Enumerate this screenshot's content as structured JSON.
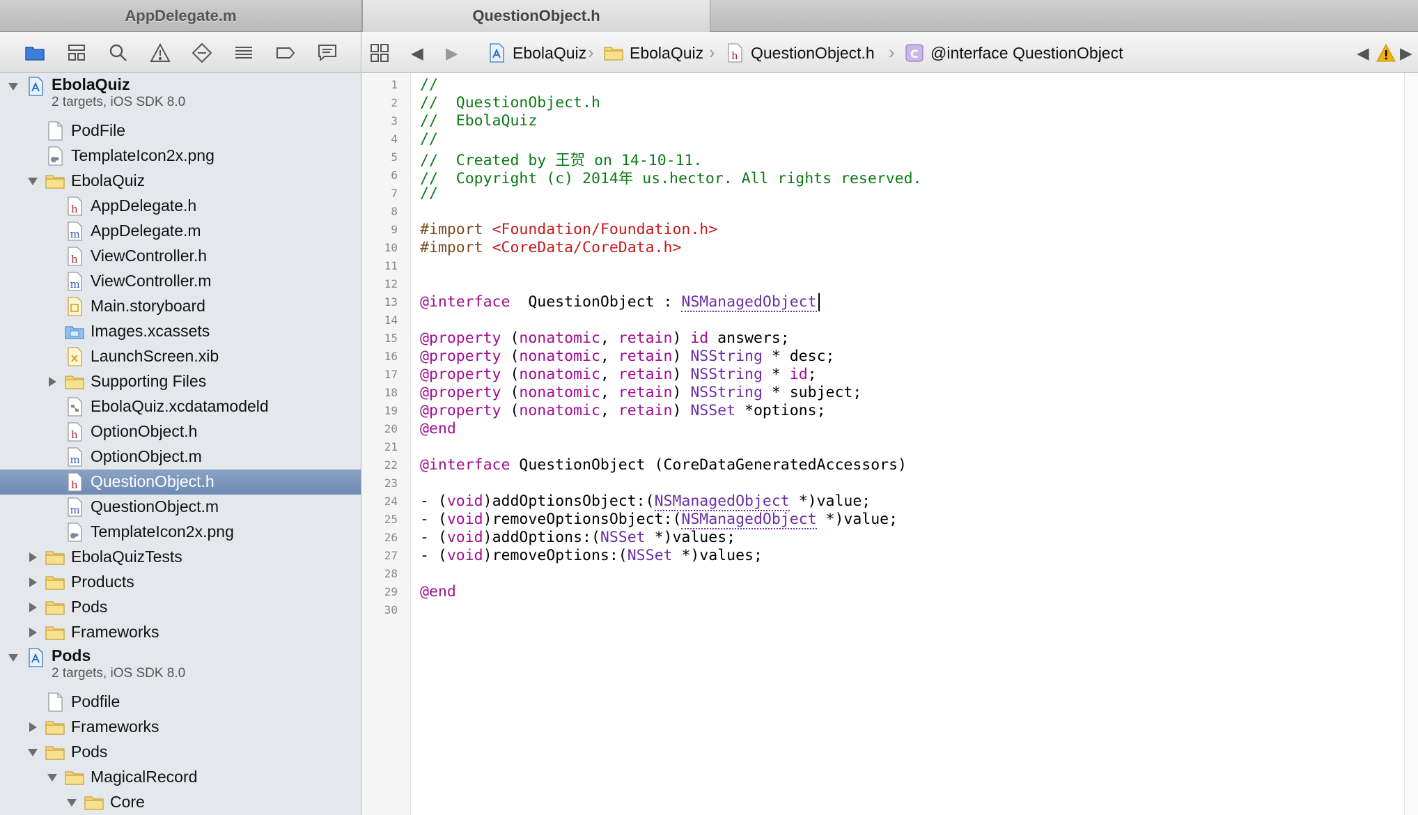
{
  "tabs": [
    {
      "label": "AppDelegate.m"
    },
    {
      "label": "QuestionObject.h"
    }
  ],
  "navigator": {
    "toolbar_icons": [
      "folder-icon",
      "hierarchy-icon",
      "search-icon",
      "warning-icon",
      "diamond-icon",
      "list-icon",
      "tag-icon",
      "chat-icon"
    ],
    "tree": [
      {
        "label": "EbolaQuiz",
        "sub": "2 targets, iOS SDK 8.0",
        "icon": "project",
        "indent": 0,
        "disclosure": "open",
        "project": true
      },
      {
        "label": "PodFile",
        "icon": "doc",
        "indent": 1
      },
      {
        "label": "TemplateIcon2x.png",
        "icon": "image",
        "indent": 1
      },
      {
        "label": "EbolaQuiz",
        "icon": "folder",
        "indent": 1,
        "disclosure": "open"
      },
      {
        "label": "AppDelegate.h",
        "icon": "h",
        "indent": 2
      },
      {
        "label": "AppDelegate.m",
        "icon": "m",
        "indent": 2
      },
      {
        "label": "ViewController.h",
        "icon": "h",
        "indent": 2
      },
      {
        "label": "ViewController.m",
        "icon": "m",
        "indent": 2
      },
      {
        "label": "Main.storyboard",
        "icon": "storyboard",
        "indent": 2
      },
      {
        "label": "Images.xcassets",
        "icon": "xcassets",
        "indent": 2
      },
      {
        "label": "LaunchScreen.xib",
        "icon": "xib",
        "indent": 2
      },
      {
        "label": "Supporting Files",
        "icon": "folder",
        "indent": 2,
        "disclosure": "closed"
      },
      {
        "label": "EbolaQuiz.xcdatamodeld",
        "icon": "datamodel",
        "indent": 2
      },
      {
        "label": "OptionObject.h",
        "icon": "h",
        "indent": 2
      },
      {
        "label": "OptionObject.m",
        "icon": "m",
        "indent": 2
      },
      {
        "label": "QuestionObject.h",
        "icon": "h",
        "indent": 2,
        "selected": true
      },
      {
        "label": "QuestionObject.m",
        "icon": "m",
        "indent": 2
      },
      {
        "label": "TemplateIcon2x.png",
        "icon": "image",
        "indent": 2
      },
      {
        "label": "EbolaQuizTests",
        "icon": "folder",
        "indent": 1,
        "disclosure": "closed"
      },
      {
        "label": "Products",
        "icon": "folder",
        "indent": 1,
        "disclosure": "closed"
      },
      {
        "label": "Pods",
        "icon": "folder",
        "indent": 1,
        "disclosure": "closed"
      },
      {
        "label": "Frameworks",
        "icon": "folder",
        "indent": 1,
        "disclosure": "closed"
      },
      {
        "label": "Pods",
        "sub": "2 targets, iOS SDK 8.0",
        "icon": "project",
        "indent": 0,
        "disclosure": "open",
        "project": true
      },
      {
        "label": "Podfile",
        "icon": "doc",
        "indent": 1
      },
      {
        "label": "Frameworks",
        "icon": "folder",
        "indent": 1,
        "disclosure": "closed"
      },
      {
        "label": "Pods",
        "icon": "folder",
        "indent": 1,
        "disclosure": "open"
      },
      {
        "label": "MagicalRecord",
        "icon": "folder",
        "indent": 2,
        "disclosure": "open"
      },
      {
        "label": "Core",
        "icon": "folder",
        "indent": 3,
        "disclosure": "open"
      }
    ]
  },
  "jumpbar": {
    "items": [
      {
        "label": "EbolaQuiz",
        "icon": "project"
      },
      {
        "label": "EbolaQuiz",
        "icon": "folder"
      },
      {
        "label": "QuestionObject.h",
        "icon": "h"
      },
      {
        "label": "@interface QuestionObject",
        "icon": "class"
      }
    ]
  },
  "editor": {
    "lines": [
      [
        [
          "c-com",
          "//"
        ]
      ],
      [
        [
          "c-com",
          "//  QuestionObject.h"
        ]
      ],
      [
        [
          "c-com",
          "//  EbolaQuiz"
        ]
      ],
      [
        [
          "c-com",
          "//"
        ]
      ],
      [
        [
          "c-com",
          "//  Created by 王贺 on 14-10-11."
        ]
      ],
      [
        [
          "c-com",
          "//  Copyright (c) 2014年 us.hector. All rights reserved."
        ]
      ],
      [
        [
          "c-com",
          "//"
        ]
      ],
      [],
      [
        [
          "c-pre",
          "#import "
        ],
        [
          "c-str",
          "<Foundation/Foundation.h>"
        ]
      ],
      [
        [
          "c-pre",
          "#import "
        ],
        [
          "c-str",
          "<CoreData/CoreData.h>"
        ]
      ],
      [],
      [],
      [
        [
          "c-kw",
          "@interface"
        ],
        [
          "",
          "  QuestionObject : "
        ],
        [
          "c-type u",
          "NSManagedObject"
        ]
      ],
      [],
      [
        [
          "c-kw",
          "@property"
        ],
        [
          "",
          " ("
        ],
        [
          "c-kw",
          "nonatomic"
        ],
        [
          "",
          ", "
        ],
        [
          "c-kw",
          "retain"
        ],
        [
          ") "
        ],
        [
          "c-kw",
          "id"
        ],
        [
          "",
          " answers;"
        ]
      ],
      [
        [
          "c-kw",
          "@property"
        ],
        [
          "",
          " ("
        ],
        [
          "c-kw",
          "nonatomic"
        ],
        [
          "",
          ", "
        ],
        [
          "c-kw",
          "retain"
        ],
        [
          ") "
        ],
        [
          "c-type",
          "NSString"
        ],
        [
          "",
          " * desc;"
        ]
      ],
      [
        [
          "c-kw",
          "@property"
        ],
        [
          "",
          " ("
        ],
        [
          "c-kw",
          "nonatomic"
        ],
        [
          "",
          ", "
        ],
        [
          "c-kw",
          "retain"
        ],
        [
          ") "
        ],
        [
          "c-type",
          "NSString"
        ],
        [
          "",
          " * "
        ],
        [
          "c-kw",
          "id"
        ],
        [
          "",
          ";"
        ]
      ],
      [
        [
          "c-kw",
          "@property"
        ],
        [
          "",
          " ("
        ],
        [
          "c-kw",
          "nonatomic"
        ],
        [
          "",
          ", "
        ],
        [
          "c-kw",
          "retain"
        ],
        [
          ") "
        ],
        [
          "c-type",
          "NSString"
        ],
        [
          "",
          " * subject;"
        ]
      ],
      [
        [
          "c-kw",
          "@property"
        ],
        [
          "",
          " ("
        ],
        [
          "c-kw",
          "nonatomic"
        ],
        [
          "",
          ", "
        ],
        [
          "c-kw",
          "retain"
        ],
        [
          ") "
        ],
        [
          "c-type",
          "NSSet"
        ],
        [
          "",
          " *options;"
        ]
      ],
      [
        [
          "c-kw",
          "@end"
        ]
      ],
      [],
      [
        [
          "c-kw",
          "@interface"
        ],
        [
          "",
          " QuestionObject (CoreDataGeneratedAccessors)"
        ]
      ],
      [],
      [
        [
          "",
          "- ("
        ],
        [
          "c-kw",
          "void"
        ],
        [
          "",
          ")addOptionsObject:("
        ],
        [
          "c-type u",
          "NSManagedObject"
        ],
        [
          "",
          " *)value;"
        ]
      ],
      [
        [
          "",
          "- ("
        ],
        [
          "c-kw",
          "void"
        ],
        [
          "",
          ")removeOptionsObject:("
        ],
        [
          "c-type u",
          "NSManagedObject"
        ],
        [
          "",
          " *)value;"
        ]
      ],
      [
        [
          "",
          "- ("
        ],
        [
          "c-kw",
          "void"
        ],
        [
          "",
          ")addOptions:("
        ],
        [
          "c-type",
          "NSSet"
        ],
        [
          "",
          " *)values;"
        ]
      ],
      [
        [
          "",
          "- ("
        ],
        [
          "c-kw",
          "void"
        ],
        [
          "",
          ")removeOptions:("
        ],
        [
          "c-type",
          "NSSet"
        ],
        [
          "",
          " *)values;"
        ]
      ],
      [],
      [
        [
          "c-kw",
          "@end"
        ]
      ],
      []
    ]
  }
}
